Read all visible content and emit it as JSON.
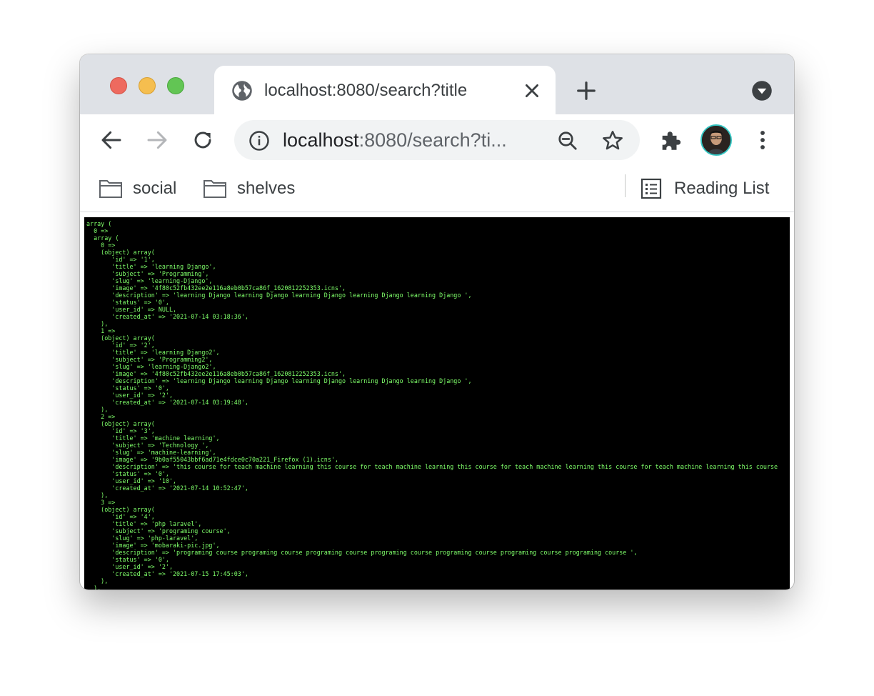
{
  "browser": {
    "tab": {
      "title": "localhost:8080/search?title"
    },
    "address_bar": {
      "host": "localhost",
      "rest": ":8080/search?ti..."
    },
    "bookmarks": [
      {
        "label": "social",
        "icon": "folder-icon"
      },
      {
        "label": "shelves",
        "icon": "folder-icon"
      }
    ],
    "reading_list_label": "Reading List"
  },
  "colors": {
    "terminal_text": "#7fff6a",
    "terminal_bg": "#000000",
    "avatar_ring": "#35c7c4"
  },
  "page": {
    "dump_lines": [
      "array (",
      "  0 =>",
      "  array (",
      "    0 =>",
      "    (object) array(",
      "       'id' => '1',",
      "       'title' => 'learning Django',",
      "       'subject' => 'Programming',",
      "       'slug' => 'learning-Django',",
      "       'image' => '4f80c52fb432ee2e116a8eb0b57ca86f_1620812252353.icns',",
      "       'description' => 'learning Django learning Django learning Django learning Django learning Django ',",
      "       'status' => '0',",
      "       'user_id' => NULL,",
      "       'created_at' => '2021-07-14 03:18:36',",
      "    ),",
      "    1 =>",
      "    (object) array(",
      "       'id' => '2',",
      "       'title' => 'learning Django2',",
      "       'subject' => 'Programming2',",
      "       'slug' => 'learning-Django2',",
      "       'image' => '4f80c52fb432ee2e116a8eb0b57ca86f_1620812252353.icns',",
      "       'description' => 'learning Django learning Django learning Django learning Django learning Django ',",
      "       'status' => '0',",
      "       'user_id' => '2',",
      "       'created_at' => '2021-07-14 03:19:48',",
      "    ),",
      "    2 =>",
      "    (object) array(",
      "       'id' => '3',",
      "       'title' => 'machine learning',",
      "       'subject' => 'Technology ',",
      "       'slug' => 'machine-learning',",
      "       'image' => '9b0af55043bbf6ad71e4fdce0c70a221_Firefox (1).icns',",
      "       'description' => 'this course for teach machine learning this course for teach machine learning this course for teach machine learning this course for teach machine learning this course",
      "       'status' => '0',",
      "       'user_id' => '10',",
      "       'created_at' => '2021-07-14 10:52:47',",
      "    ),",
      "    3 =>",
      "    (object) array(",
      "       'id' => '4',",
      "       'title' => 'php laravel',",
      "       'subject' => 'programing course',",
      "       'slug' => 'php-laravel',",
      "       'image' => 'mobaraki-pic.jpg',",
      "       'description' => 'programing course programing course programing course programing course programing course programing course programing course ',",
      "       'status' => '0',",
      "       'user_id' => '2',",
      "       'created_at' => '2021-07-15 17:45:03',",
      "    ),",
      "  ),"
    ]
  }
}
